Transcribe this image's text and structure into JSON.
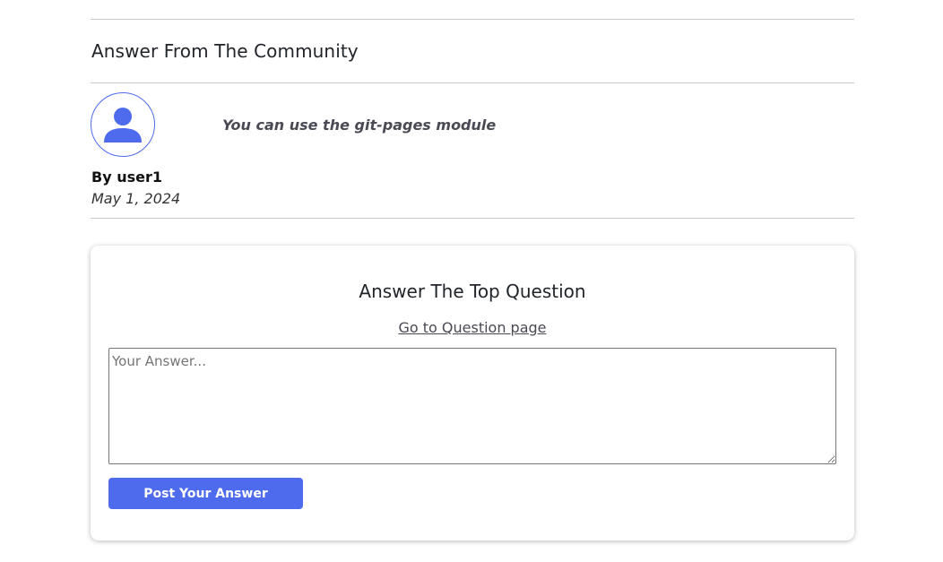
{
  "answers_section": {
    "title": "Answer From The Community",
    "answers": [
      {
        "text": "You can use the git-pages module",
        "author": "By user1",
        "date": "May 1, 2024",
        "avatar_icon": "user-icon"
      }
    ]
  },
  "answer_form": {
    "title": "Answer The Top Question",
    "link_text": "Go to Question page",
    "input_placeholder": "Your Answer...",
    "input_value": "",
    "submit_label": "Post Your Answer"
  },
  "colors": {
    "accent": "#4f6bed",
    "text": "#212529",
    "divider": "#c9c9c9"
  }
}
